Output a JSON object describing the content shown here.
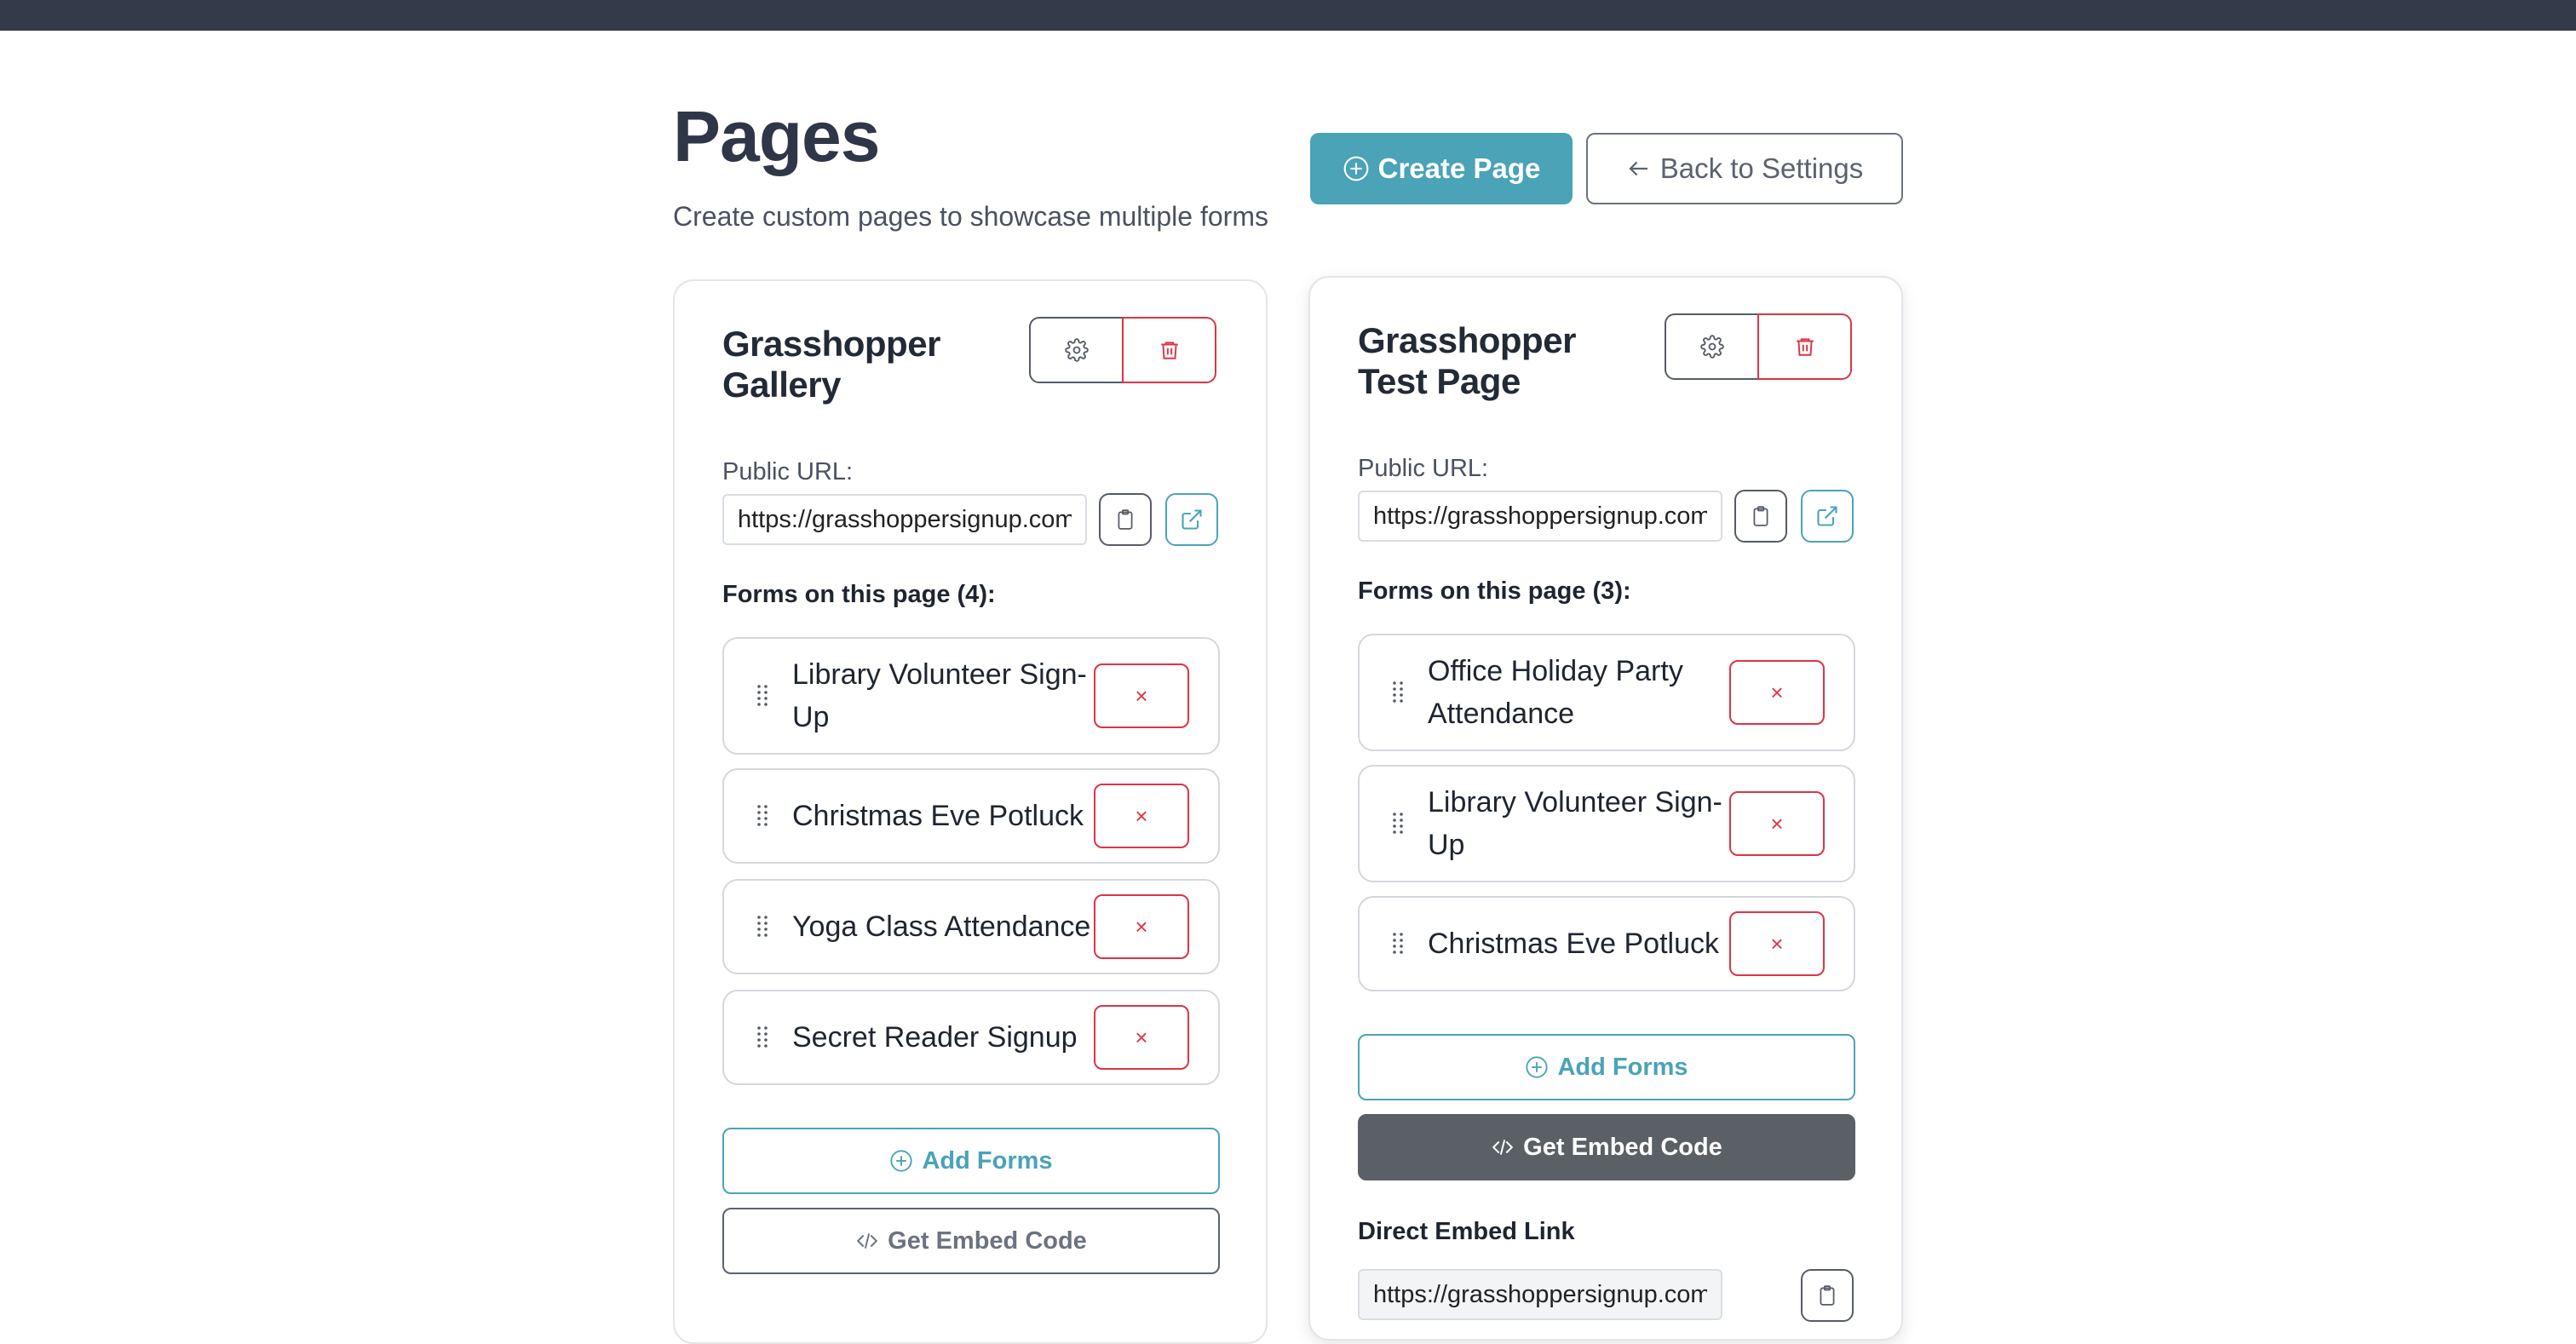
{
  "header": {
    "title": "Pages",
    "subtitle": "Create custom pages to showcase multiple forms",
    "create_label": "Create Page",
    "back_label": "Back to Settings"
  },
  "colors": {
    "accent": "#4aa3b7",
    "danger": "#dc3545",
    "topbar": "#333a4a"
  },
  "cards": [
    {
      "title": "Grasshopper Gallery",
      "url_label": "Public URL:",
      "url_value": "https://grasshoppersignup.com",
      "forms_heading": "Forms on this page (4):",
      "forms": [
        "Library Volunteer Sign-Up",
        "Christmas Eve Potluck",
        "Yoga Class Attendance",
        "Secret Reader Signup"
      ],
      "remove_label": "×",
      "add_forms_label": "Add Forms",
      "embed_label": "Get Embed Code"
    },
    {
      "title": "Grasshopper Test Page",
      "url_label": "Public URL:",
      "url_value": "https://grasshoppersignup.com",
      "forms_heading": "Forms on this page (3):",
      "forms": [
        "Office Holiday Party Attendance",
        "Library Volunteer Sign-Up",
        "Christmas Eve Potluck"
      ],
      "remove_label": "×",
      "add_forms_label": "Add Forms",
      "embed_label": "Get Embed Code",
      "direct_embed_label": "Direct Embed Link",
      "direct_embed_value": "https://grasshoppersignup.com/em"
    }
  ]
}
